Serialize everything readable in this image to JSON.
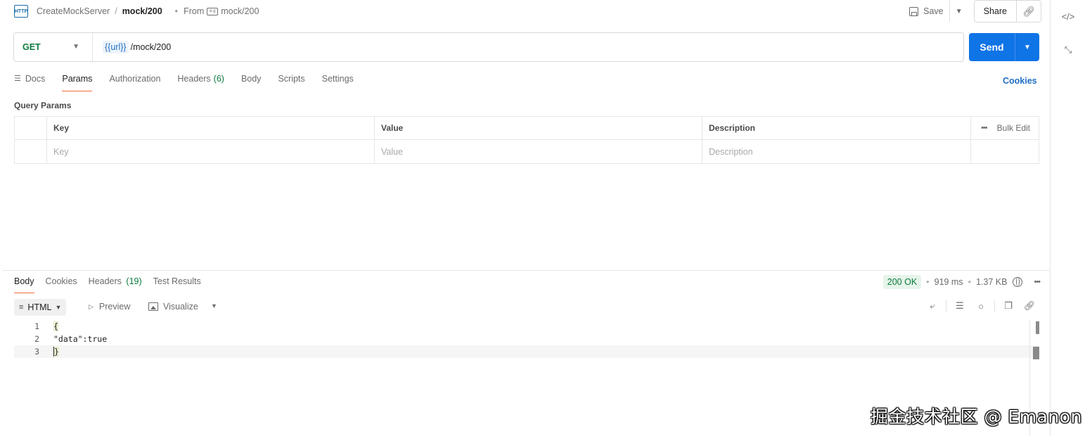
{
  "breadcrumb": {
    "icon": "http-icon",
    "icon_text": "HTTP",
    "parent": "CreateMockServer",
    "separator": "/",
    "current": "mock/200"
  },
  "from": {
    "dot": "•",
    "label": "From",
    "source": "mock/200"
  },
  "header_actions": {
    "save_label": "Save",
    "share_label": "Share"
  },
  "request": {
    "method": "GET",
    "method_color": "#0b7a3e",
    "url_variable": "{{url}}",
    "url_path": "/mock/200",
    "send_label": "Send",
    "send_color": "#0f74e6"
  },
  "request_tabs": [
    {
      "label": "Docs",
      "icon": "docs-icon"
    },
    {
      "label": "Params",
      "active": true
    },
    {
      "label": "Authorization"
    },
    {
      "label": "Headers",
      "count": "(6)"
    },
    {
      "label": "Body"
    },
    {
      "label": "Scripts"
    },
    {
      "label": "Settings"
    }
  ],
  "cookies_link": "Cookies",
  "query_params": {
    "title": "Query Params",
    "columns": [
      "Key",
      "Value",
      "Description"
    ],
    "bulk_edit": "Bulk Edit",
    "placeholders": [
      "Key",
      "Value",
      "Description"
    ]
  },
  "response_tabs": [
    {
      "label": "Body",
      "active": true
    },
    {
      "label": "Cookies"
    },
    {
      "label": "Headers",
      "count": "(19)"
    },
    {
      "label": "Test Results"
    }
  ],
  "response_status": {
    "status": "200 OK",
    "time": "919 ms",
    "size": "1.37 KB",
    "status_color": "#0b7a3e"
  },
  "response_toolbar": {
    "format": "HTML",
    "preview": "Preview",
    "visualize": "Visualize"
  },
  "code_lines": [
    {
      "n": "1",
      "text": "{"
    },
    {
      "n": "2",
      "text": "\"data\":true"
    },
    {
      "n": "3",
      "text": "}"
    }
  ],
  "accent_color": "#f26b3a",
  "watermark": "掘金技术社区 @ Emanon"
}
